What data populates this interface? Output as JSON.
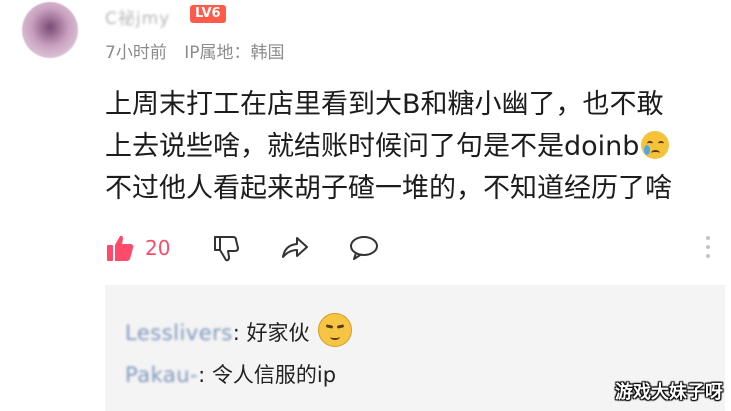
{
  "comment": {
    "username": "C祕jmy",
    "level_badge": "LV6",
    "time": "7小时前",
    "ip_location": "IP属地：韩国",
    "lines": [
      "上周末打工在店里看到大B和糖小幽了，也不敢",
      "上去说些啥，就结账时候问了句是不是doinb",
      "不过他人看起来胡子碴一堆的，不知道经历了啥"
    ],
    "emoji_icon": "crying-face-icon",
    "like_count": "20"
  },
  "actions": {
    "like_icon": "thumbs-up-icon",
    "dislike_icon": "thumbs-down-icon",
    "share_icon": "share-arrow-icon",
    "comment_icon": "comment-bubble-icon",
    "more_icon": "vertical-ellipsis-icon",
    "accent_color": "#ff4a6a"
  },
  "replies": [
    {
      "name": "Lesslivers",
      "separator": ":",
      "text": "好家伙",
      "emoji_icon": "squinting-face-icon"
    },
    {
      "name": "Pakau-",
      "separator": ":",
      "text": "令人信服的ip"
    }
  ],
  "watermark": "游戏大妹子呀"
}
